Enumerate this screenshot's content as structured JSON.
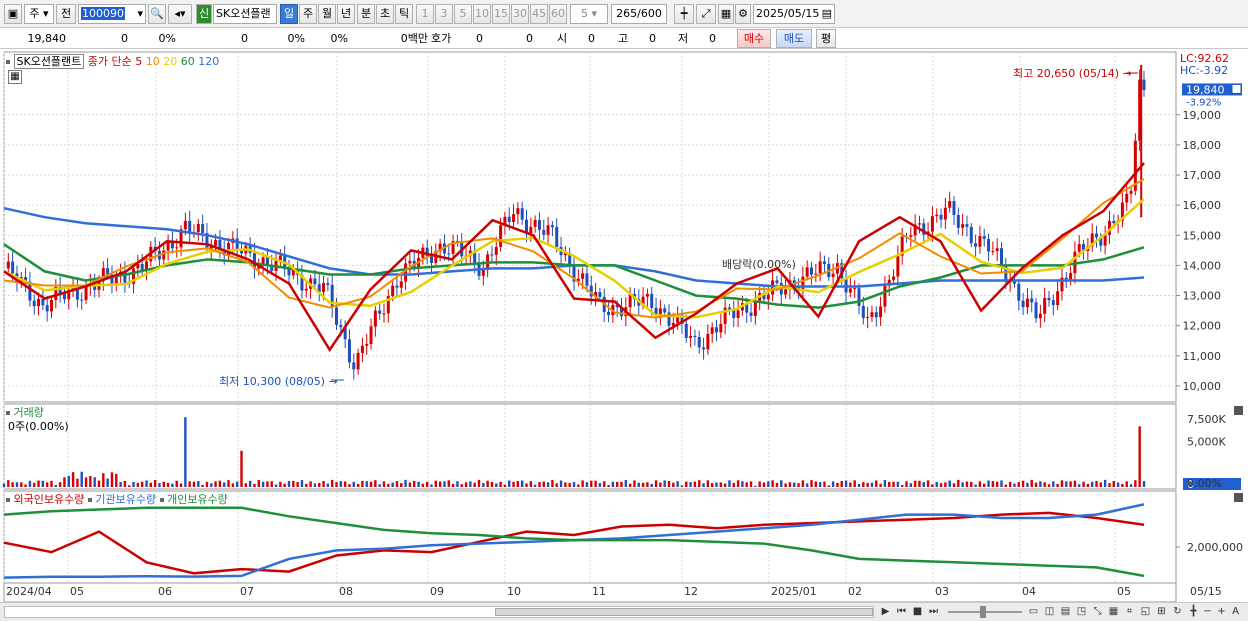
{
  "toolbar": {
    "period_select": "주",
    "prev_label": "전",
    "code": "100090",
    "new_badge": "신",
    "stock_name": "SK오션플랜",
    "periods": [
      "일",
      "주",
      "월",
      "년",
      "분",
      "초",
      "틱"
    ],
    "active_period": "일",
    "intervals": [
      "1",
      "3",
      "5",
      "10",
      "15",
      "30",
      "45",
      "60"
    ],
    "unit_value": "5",
    "count": "265",
    "count_total": "/600",
    "date": "2025/05/15"
  },
  "quote": {
    "price": "19,840",
    "change": "0",
    "change_pct": "0%",
    "volume": "0",
    "volume_pct": "0%",
    "pct3": "0%",
    "amount": "0백만",
    "hoga_label": "호가",
    "hoga_value": "0",
    "hoga_value2": "0",
    "open_label": "시",
    "open": "0",
    "high_label": "고",
    "high": "0",
    "low_label": "저",
    "low": "0",
    "buy_label": "매수",
    "sell_label": "매도",
    "eval_label": "평"
  },
  "legend": {
    "name": "SK오션플랜트",
    "type_label": "종가 단순",
    "ma": [
      {
        "label": "5",
        "color": "#cc0000"
      },
      {
        "label": "10",
        "color": "#f28c00"
      },
      {
        "label": "20",
        "color": "#e6d000"
      },
      {
        "label": "60",
        "color": "#1f8f3a"
      },
      {
        "label": "120",
        "color": "#2f6fd6"
      }
    ],
    "lc": "LC:92.62",
    "hc": "HC:-3.92"
  },
  "annotations": {
    "high": "최고 20,650 (05/14)",
    "low": "최저 10,300 (08/05)",
    "dividend": "배당락(0.00%)",
    "current_price": "19,840",
    "current_pct": "-3.92%"
  },
  "volume_panel": {
    "title": "거래량",
    "value": "0주(0.00%)",
    "axis": [
      "7,500K",
      "5,000K",
      "0",
      "0.00%"
    ]
  },
  "holder_panel": {
    "series": [
      {
        "name": "외국인보유수량",
        "color": "#cc0000"
      },
      {
        "name": "기관보유수량",
        "color": "#2f6fd6"
      },
      {
        "name": "개인보유수량",
        "color": "#1f8f3a"
      }
    ],
    "axis": [
      "2,000,000"
    ]
  },
  "price_axis": [
    "19,000",
    "18,000",
    "17,000",
    "16,000",
    "15,000",
    "14,000",
    "13,000",
    "12,000",
    "11,000",
    "10,000"
  ],
  "date_axis": [
    "2024/04",
    "05",
    "06",
    "07",
    "08",
    "09",
    "10",
    "11",
    "12",
    "2025/01",
    "02",
    "03",
    "04",
    "05",
    "05/15"
  ],
  "colors": {
    "up": "#d60000",
    "down": "#1f4fbf",
    "current": "#1f5fd0"
  },
  "chart_data": {
    "type": "candlestick",
    "title": "SK오션플랜트",
    "x_range": [
      "2024/04",
      "2025/05/15"
    ],
    "ylim": [
      10000,
      20650
    ],
    "high": {
      "value": 20650,
      "date": "05/14"
    },
    "low": {
      "value": 10300,
      "date": "08/05"
    },
    "last_close": 19840,
    "close_series": [
      {
        "date": "2024-04-01",
        "close": 13900
      },
      {
        "date": "2024-04-15",
        "close": 12700
      },
      {
        "date": "2024-05-01",
        "close": 13300
      },
      {
        "date": "2024-05-20",
        "close": 13900
      },
      {
        "date": "2024-06-05",
        "close": 15200
      },
      {
        "date": "2024-06-20",
        "close": 14600
      },
      {
        "date": "2024-07-05",
        "close": 14100
      },
      {
        "date": "2024-07-25",
        "close": 13200
      },
      {
        "date": "2024-08-05",
        "close": 10700
      },
      {
        "date": "2024-08-20",
        "close": 13600
      },
      {
        "date": "2024-09-05",
        "close": 14700
      },
      {
        "date": "2024-09-20",
        "close": 14000
      },
      {
        "date": "2024-10-01",
        "close": 15800
      },
      {
        "date": "2024-10-15",
        "close": 14900
      },
      {
        "date": "2024-11-01",
        "close": 12600
      },
      {
        "date": "2024-11-20",
        "close": 12800
      },
      {
        "date": "2024-12-05",
        "close": 11400
      },
      {
        "date": "2024-12-20",
        "close": 12500
      },
      {
        "date": "2025-01-10",
        "close": 13500
      },
      {
        "date": "2025-01-25",
        "close": 14000
      },
      {
        "date": "2025-02-05",
        "close": 12000
      },
      {
        "date": "2025-02-20",
        "close": 15100
      },
      {
        "date": "2025-03-05",
        "close": 15800
      },
      {
        "date": "2025-03-20",
        "close": 14600
      },
      {
        "date": "2025-04-07",
        "close": 12200
      },
      {
        "date": "2025-04-20",
        "close": 14200
      },
      {
        "date": "2025-05-01",
        "close": 15200
      },
      {
        "date": "2025-05-10",
        "close": 16100
      },
      {
        "date": "2025-05-14",
        "close": 20600
      },
      {
        "date": "2025-05-15",
        "close": 19840
      }
    ],
    "ma_series": [
      {
        "name": "5",
        "values": [
          13800,
          12900,
          13300,
          13800,
          14800,
          14700,
          14200,
          13400,
          11200,
          13200,
          14500,
          14200,
          15500,
          15000,
          12900,
          12800,
          11600,
          12400,
          13400,
          13900,
          12300,
          14800,
          15600,
          14800,
          12500,
          13900,
          15000,
          15800,
          17400
        ]
      },
      {
        "name": "60",
        "values": [
          14700,
          13800,
          13500,
          13700,
          14000,
          14200,
          14100,
          13900,
          13700,
          13700,
          13900,
          14000,
          14100,
          14100,
          14000,
          14000,
          13500,
          13000,
          12900,
          12700,
          12600,
          12800,
          13300,
          13600,
          14000,
          14000,
          14000,
          14200,
          14600
        ]
      },
      {
        "name": "120",
        "values": [
          15900,
          15600,
          15400,
          15300,
          15200,
          15000,
          14700,
          14300,
          13900,
          13700,
          13700,
          13800,
          13900,
          13900,
          14000,
          14000,
          13800,
          13500,
          13400,
          13300,
          13300,
          13300,
          13400,
          13500,
          13500,
          13500,
          13500,
          13500,
          13600
        ]
      }
    ],
    "volume_peaks_k": [
      {
        "date": "2024-06-05",
        "value": 7700
      },
      {
        "date": "2024-06-25",
        "value": 4000
      },
      {
        "date": "2025-05-14",
        "value": 6700
      }
    ],
    "holders": [
      {
        "name": "외국인보유수량",
        "values": [
          2250,
          1700,
          2900,
          1100,
          450,
          700,
          550,
          1500,
          1800,
          1700,
          2300,
          2900,
          2700,
          3200,
          3300,
          3100,
          3300,
          3400,
          3500,
          3600,
          3700,
          3900,
          4000,
          3700,
          3300
        ]
      },
      {
        "name": "기관보유수량",
        "values": [
          200,
          250,
          250,
          280,
          260,
          300,
          1300,
          1800,
          1900,
          2100,
          2200,
          2300,
          2400,
          2500,
          2700,
          2900,
          3100,
          3300,
          3600,
          3900,
          3900,
          3700,
          3700,
          3900,
          4500
        ]
      },
      {
        "name": "개인보유수량",
        "values": [
          3900,
          4100,
          4200,
          4300,
          4300,
          4300,
          3800,
          3400,
          3000,
          2800,
          2700,
          2500,
          2400,
          2400,
          2400,
          2300,
          2200,
          1800,
          1300,
          1200,
          1100,
          1000,
          900,
          800,
          300
        ]
      }
    ]
  }
}
